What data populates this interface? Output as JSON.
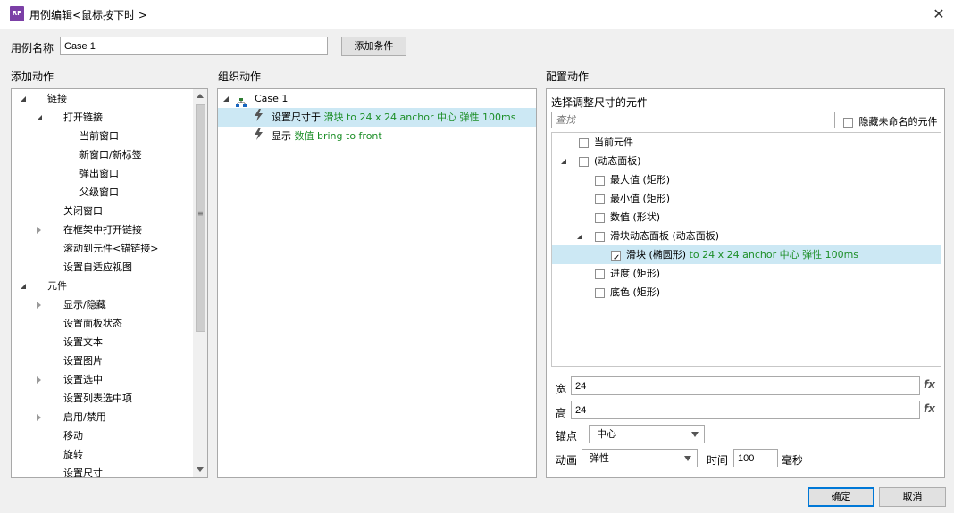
{
  "window": {
    "title": "用例编辑<鼠标按下时 >",
    "icon_text": "RP"
  },
  "case_name": {
    "label": "用例名称",
    "value": "Case 1",
    "add_condition": "添加条件"
  },
  "sections": {
    "add_action": "添加动作",
    "organize_action": "组织动作",
    "configure_action": "配置动作"
  },
  "add_action_tree": [
    {
      "label": "链接",
      "level": 0,
      "expand": "open"
    },
    {
      "label": "打开链接",
      "level": 1,
      "expand": "open"
    },
    {
      "label": "当前窗口",
      "level": 2,
      "expand": "none"
    },
    {
      "label": "新窗口/新标签",
      "level": 2,
      "expand": "none"
    },
    {
      "label": "弹出窗口",
      "level": 2,
      "expand": "none"
    },
    {
      "label": "父级窗口",
      "level": 2,
      "expand": "none"
    },
    {
      "label": "关闭窗口",
      "level": 1,
      "expand": "none"
    },
    {
      "label": "在框架中打开链接",
      "level": 1,
      "expand": "closed"
    },
    {
      "label": "滚动到元件<锚链接>",
      "level": 1,
      "expand": "none"
    },
    {
      "label": "设置自适应视图",
      "level": 1,
      "expand": "none"
    },
    {
      "label": "元件",
      "level": 0,
      "expand": "open"
    },
    {
      "label": "显示/隐藏",
      "level": 1,
      "expand": "closed"
    },
    {
      "label": "设置面板状态",
      "level": 1,
      "expand": "none"
    },
    {
      "label": "设置文本",
      "level": 1,
      "expand": "none"
    },
    {
      "label": "设置图片",
      "level": 1,
      "expand": "none"
    },
    {
      "label": "设置选中",
      "level": 1,
      "expand": "closed"
    },
    {
      "label": "设置列表选中项",
      "level": 1,
      "expand": "none"
    },
    {
      "label": "启用/禁用",
      "level": 1,
      "expand": "closed"
    },
    {
      "label": "移动",
      "level": 1,
      "expand": "none"
    },
    {
      "label": "旋转",
      "level": 1,
      "expand": "none"
    },
    {
      "label": "设置尺寸",
      "level": 1,
      "expand": "none"
    }
  ],
  "organize": {
    "case_label": "Case 1",
    "actions": [
      {
        "verb": "设置尺寸于",
        "detail": "滑块 to 24 x 24 anchor 中心 弹性 100ms",
        "selected": true
      },
      {
        "verb": "显示",
        "detail": "数值 bring to front",
        "selected": false
      }
    ]
  },
  "configure": {
    "select_label": "选择调整尺寸的元件",
    "search_placeholder": "查找",
    "hide_unnamed_label": "隐藏未命名的元件",
    "tree": [
      {
        "label": "当前元件",
        "level": 0,
        "expand": "none",
        "checked": false,
        "detail": ""
      },
      {
        "label": "(动态面板)",
        "level": 0,
        "expand": "open",
        "checked": false,
        "detail": ""
      },
      {
        "label": "最大值 (矩形)",
        "level": 1,
        "expand": "none",
        "checked": false,
        "detail": ""
      },
      {
        "label": "最小值 (矩形)",
        "level": 1,
        "expand": "none",
        "checked": false,
        "detail": ""
      },
      {
        "label": "数值 (形状)",
        "level": 1,
        "expand": "none",
        "checked": false,
        "detail": ""
      },
      {
        "label": "滑块动态面板 (动态面板)",
        "level": 1,
        "expand": "open",
        "checked": false,
        "detail": ""
      },
      {
        "label": "滑块 (椭圆形)",
        "level": 2,
        "expand": "none",
        "checked": true,
        "detail": "to 24 x 24 anchor 中心 弹性 100ms"
      },
      {
        "label": "进度 (矩形)",
        "level": 1,
        "expand": "none",
        "checked": false,
        "detail": ""
      },
      {
        "label": "底色 (矩形)",
        "level": 1,
        "expand": "none",
        "checked": false,
        "detail": ""
      }
    ],
    "width_label": "宽",
    "width_value": "24",
    "height_label": "高",
    "height_value": "24",
    "fx": "fx",
    "anchor_label": "锚点",
    "anchor_value": "中心",
    "animation_label": "动画",
    "animation_value": "弹性",
    "time_label": "时间",
    "time_value": "100",
    "time_unit": "毫秒"
  },
  "footer": {
    "ok": "确定",
    "cancel": "取消"
  },
  "colors": {
    "selection": "#cce8f4",
    "green_text": "#1c8e27",
    "ok_border": "#0078d7"
  }
}
